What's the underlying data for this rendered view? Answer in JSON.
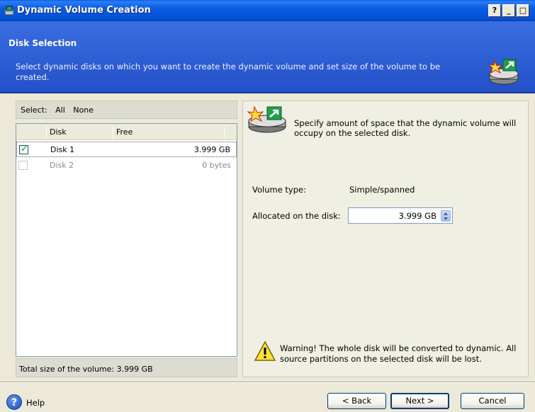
{
  "window": {
    "title": "Dynamic Volume Creation",
    "help_btn": "?",
    "minimize_btn": "_",
    "maximize_btn": "□",
    "close_btn": "✕"
  },
  "header": {
    "title": "Disk Selection",
    "description": "Select dynamic disks on which you want to create the dynamic volume and set size of the volume to be created."
  },
  "select_bar": {
    "label": "Select:",
    "all": "All",
    "none": "None"
  },
  "disk_list": {
    "columns": [
      "Disk",
      "Free"
    ],
    "rows": [
      {
        "disk": "Disk 1",
        "free": "3.999 GB",
        "checked": true,
        "enabled": true
      },
      {
        "disk": "Disk 2",
        "free": "0 bytes",
        "checked": false,
        "enabled": false
      }
    ]
  },
  "total": {
    "text": "Total size of the volume: 3.999 GB"
  },
  "right_panel": {
    "instruction": "Specify amount of space that the dynamic volume will occupy on the selected disk.",
    "volume_type_label": "Volume type:",
    "volume_type_value": "Simple/spanned",
    "allocated_label": "Allocated on the disk:",
    "allocated_value": "3.999 GB",
    "warning": "Warning! The whole disk will be converted to dynamic. All source partitions on the selected disk will be lost."
  },
  "footer": {
    "help_label": "Help",
    "back_label": "< Back",
    "next_label": "Next >",
    "cancel_label": "Cancel"
  },
  "colors": {
    "titlebar": "#0a5ae0",
    "header": "#2f5fd8",
    "checkmark": "#21a121",
    "background": "#ece9d8"
  }
}
